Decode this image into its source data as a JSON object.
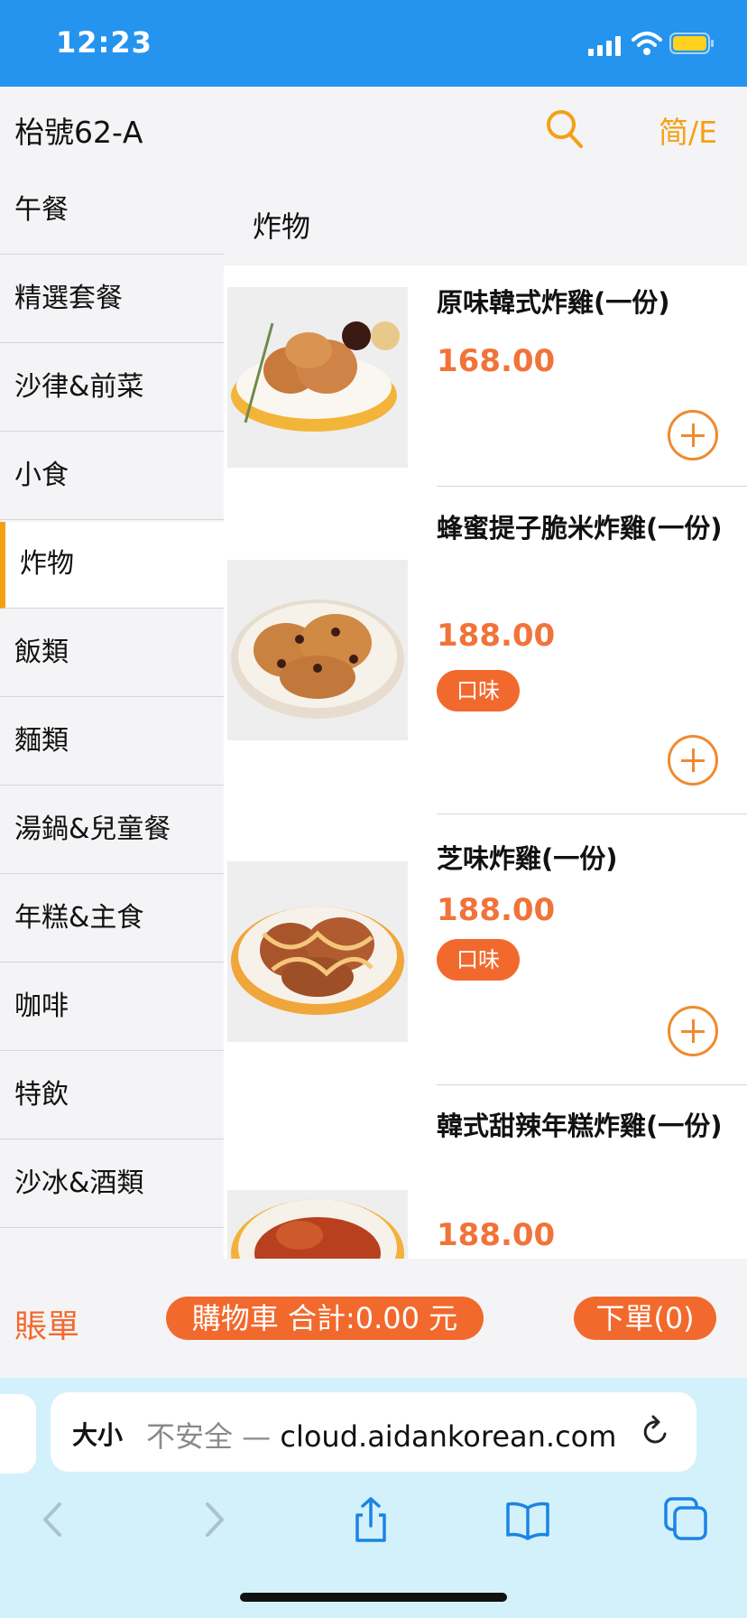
{
  "status_bar": {
    "time": "12:23"
  },
  "header": {
    "title": "枱號62-A",
    "lang_toggle": "简/E"
  },
  "sidebar": {
    "categories": [
      {
        "label": "午餐"
      },
      {
        "label": "精選套餐"
      },
      {
        "label": "沙律&前菜"
      },
      {
        "label": "小食"
      },
      {
        "label": "炸物",
        "active": true
      },
      {
        "label": "飯類"
      },
      {
        "label": "麵類"
      },
      {
        "label": "湯鍋&兒童餐"
      },
      {
        "label": "年糕&主食"
      },
      {
        "label": "咖啡"
      },
      {
        "label": "特飲"
      },
      {
        "label": "沙冰&酒類"
      }
    ]
  },
  "section": {
    "title": "炸物"
  },
  "products": [
    {
      "name": "原味韓式炸雞(一份)",
      "price": "168.00"
    },
    {
      "name": "蜂蜜提子脆米炸雞(一份)",
      "price": "188.00",
      "option": "口味"
    },
    {
      "name": "芝味炸雞(一份)",
      "price": "188.00",
      "option": "口味"
    },
    {
      "name": "韓式甜辣年糕炸雞(一份)",
      "price": "188.00"
    }
  ],
  "bottom_bar": {
    "bill": "賬單",
    "cart": "購物車 合計:0.00 元",
    "order": "下單(0)"
  },
  "browser": {
    "text_size": "大小",
    "security": "不安全 —",
    "domain": "cloud.aidankorean.com"
  },
  "colors": {
    "accent": "#f5a014",
    "brand_orange": "#f2692d",
    "status_bar": "#2594ee"
  }
}
